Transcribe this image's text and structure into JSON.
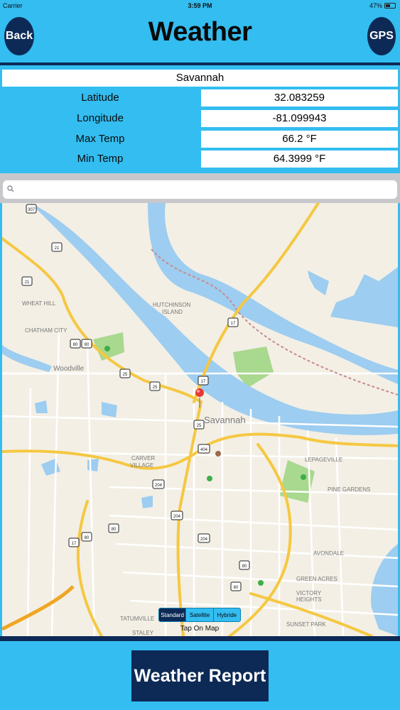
{
  "status_bar": {
    "carrier": "Carrier",
    "time": "3:59 PM",
    "battery": "47%"
  },
  "header": {
    "title": "Weather",
    "back_label": "Back",
    "gps_label": "GPS"
  },
  "location": {
    "city": "Savannah",
    "fields": [
      {
        "label": "Latitude",
        "value": "32.083259"
      },
      {
        "label": "Longitude",
        "value": "-81.099943"
      },
      {
        "label": "Max Temp",
        "value": "66.2 °F"
      },
      {
        "label": "Min Temp",
        "value": "64.3999 °F"
      }
    ]
  },
  "search": {
    "placeholder": ""
  },
  "map": {
    "labels": {
      "savannah": "Savannah",
      "hutchinson": "HUTCHINSON",
      "island": "ISLAND",
      "wheat_hill": "WHEAT HILL",
      "chatham_city": "CHATHAM CITY",
      "woodville": "Woodville",
      "carver": "CARVER",
      "village": "VILLAGE",
      "lepageville": "LEPAGEVILLE",
      "pine_gardens": "PINE GARDENS",
      "avondale": "AVONDALE",
      "green_acres": "GREEN ACRES",
      "victory": "VICTORY",
      "heights": "HEIGHTS",
      "sunset_park": "SUNSET PARK",
      "tatumville": "TATUMVILLE",
      "staley": "STALEY"
    },
    "shields": [
      "307",
      "21",
      "21",
      "80",
      "80",
      "25",
      "17",
      "25",
      "25",
      "17",
      "404",
      "204",
      "204",
      "80",
      "17",
      "80",
      "204",
      "80",
      "80"
    ]
  },
  "map_type": {
    "options": [
      "Standard",
      "Satellite",
      "Hybride"
    ],
    "selected": "Standard"
  },
  "tap_hint": "Tap On Map",
  "footer": {
    "report_label": "Weather Report"
  }
}
